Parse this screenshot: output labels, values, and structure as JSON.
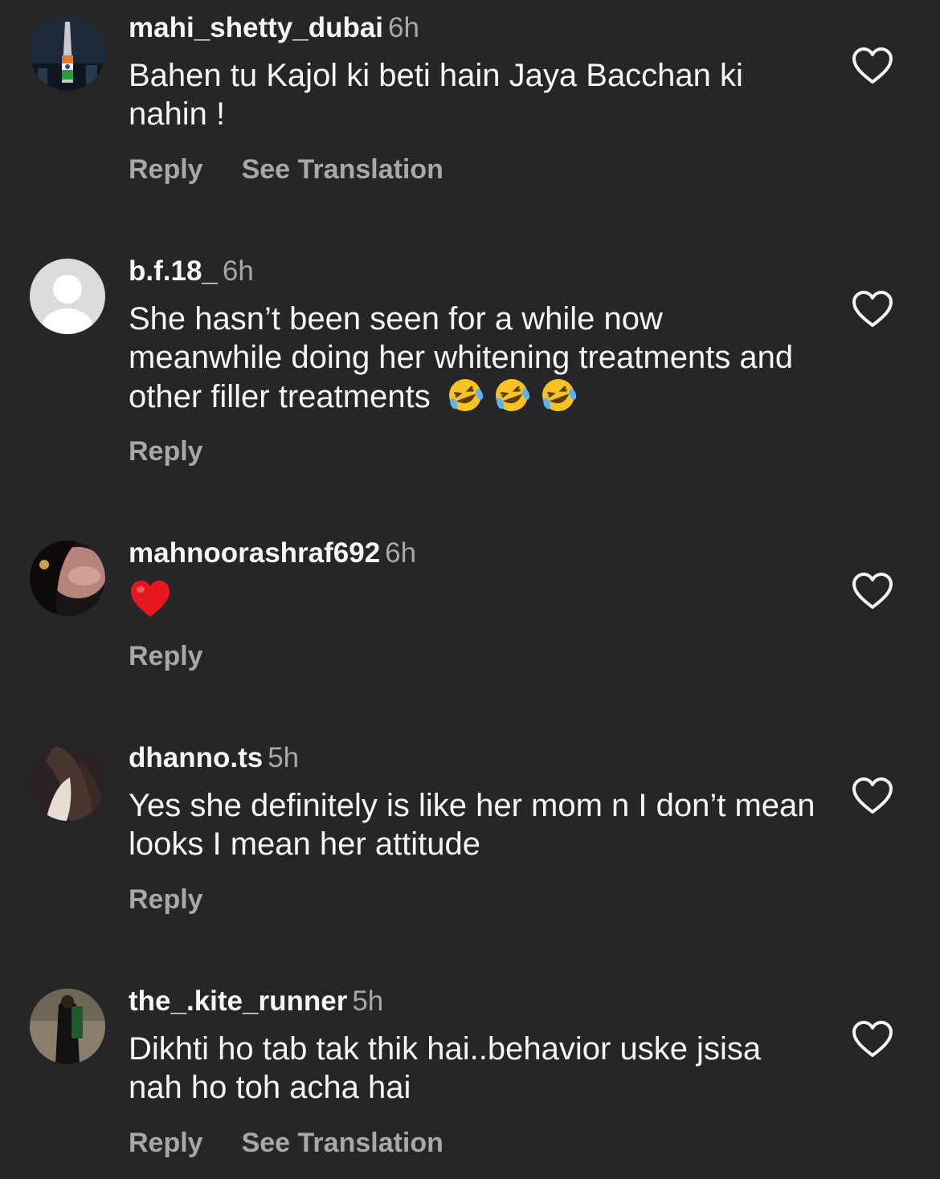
{
  "comments": [
    {
      "username": "mahi_shetty_dubai",
      "time": "6h",
      "text": "Bahen tu Kajol ki beti hain  Jaya Bacchan ki nahin !",
      "reply_label": "Reply",
      "translation_label": "See Translation"
    },
    {
      "username": "b.f.18_",
      "time": "6h",
      "text": "She hasn’t been seen for a while now meanwhile doing her whitening treatments and other filler treatments",
      "emoji": "rolling-on-floor-laughing x3",
      "reply_label": "Reply"
    },
    {
      "username": "mahnoorashraf692",
      "time": "6h",
      "emoji": "red-heart",
      "reply_label": "Reply"
    },
    {
      "username": "dhanno.ts",
      "time": "5h",
      "text": "Yes she definitely is like her mom n I don’t mean looks I mean her attitude",
      "reply_label": "Reply"
    },
    {
      "username": "the_.kite_runner",
      "time": "5h",
      "text": "Dikhti ho tab tak thik hai..behavior uske jsisa nah ho toh acha hai",
      "reply_label": "Reply",
      "translation_label": "See Translation"
    }
  ],
  "colors": {
    "background": "#262628",
    "primary_text": "#f5f5f5",
    "secondary_text": "#a8a8a8",
    "heart_outline": "#f5f5f5"
  },
  "icons": [
    "heart-outline-icon",
    "default-avatar-icon",
    "laughing-emoji",
    "red-heart-emoji"
  ]
}
